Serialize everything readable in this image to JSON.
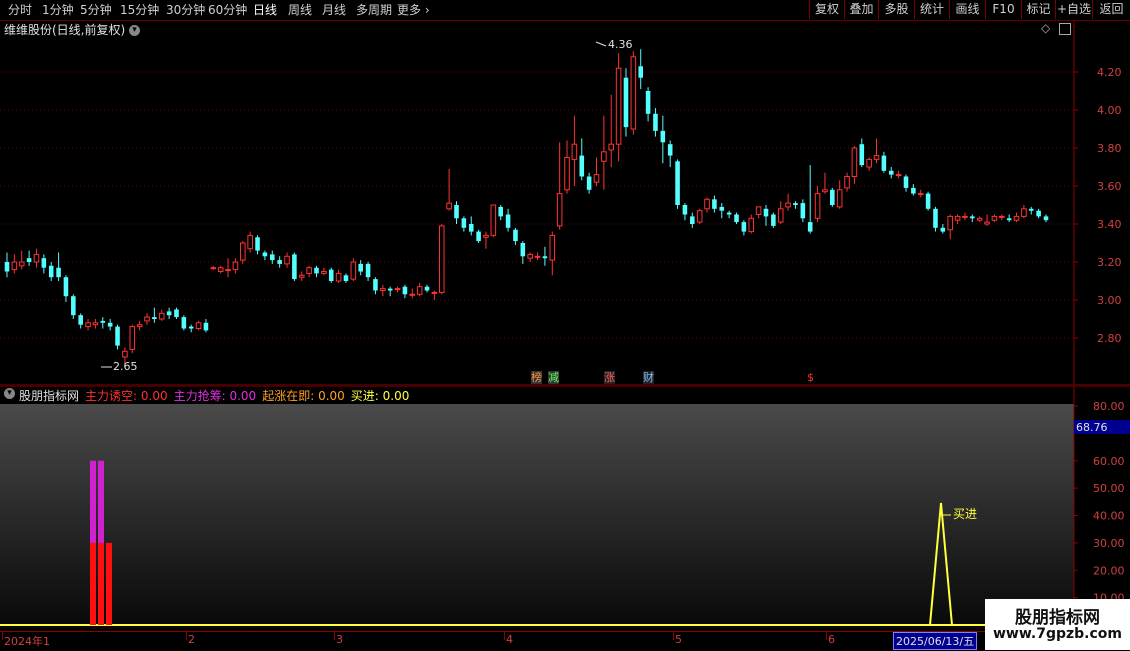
{
  "toolbar": {
    "periods": [
      "分时",
      "1分钟",
      "5分钟",
      "15分钟",
      "30分钟",
      "60分钟",
      "日线",
      "周线",
      "月线",
      "多周期",
      "更多"
    ],
    "more_arrow": "›",
    "right_buttons": [
      "复权",
      "叠加",
      "多股",
      "统计",
      "画线",
      "F10",
      "标记",
      "+自选",
      "返回"
    ],
    "active": "日线"
  },
  "main_panel": {
    "title": "维维股份(日线,前复权)",
    "price_ticks": [
      "4.20",
      "4.00",
      "3.80",
      "3.60",
      "3.40",
      "3.20",
      "3.00",
      "2.80"
    ],
    "high_label": "4.36",
    "low_label": "2.65",
    "markers": [
      "榜",
      "减",
      "涨",
      "财",
      "$"
    ]
  },
  "indicator_panel": {
    "name": "股朋指标网",
    "items": [
      {
        "label": "主力诱空:",
        "value": "0.00",
        "color": "#ff3030"
      },
      {
        "label": "主力抢筹:",
        "value": "0.00",
        "color": "#e030e0"
      },
      {
        "label": "起涨在即:",
        "value": "0.00",
        "color": "#ffa020"
      },
      {
        "label": "买进:",
        "value": "0.00",
        "color": "#ffff40"
      }
    ],
    "y_ticks": [
      "80.00",
      "60.00",
      "50.00",
      "40.00",
      "30.00",
      "20.00",
      "10.00"
    ],
    "current_value": "68.76",
    "buy_label": "买进"
  },
  "date_axis": {
    "labels": [
      "2024年1",
      "2",
      "3",
      "4",
      "5",
      "6"
    ],
    "cursor_date": "2025/06/13/五"
  },
  "watermark": {
    "line1": "股朋指标网",
    "line2": "www.7gpzb.com"
  },
  "chart_data": {
    "type": "candlestick",
    "title": "维维股份(日线,前复权)",
    "ylim": [
      2.6,
      4.45
    ],
    "price_ticks": [
      2.8,
      3.0,
      3.2,
      3.4,
      3.6,
      3.8,
      4.0,
      4.2
    ],
    "annotations": [
      {
        "label": "4.36",
        "type": "high"
      },
      {
        "label": "2.65",
        "type": "low"
      }
    ],
    "candles": [
      [
        3.2,
        3.15,
        3.25,
        3.12
      ],
      [
        3.16,
        3.2,
        3.24,
        3.14
      ],
      [
        3.18,
        3.2,
        3.26,
        3.16
      ],
      [
        3.22,
        3.2,
        3.26,
        3.18
      ],
      [
        3.2,
        3.24,
        3.27,
        3.17
      ],
      [
        3.22,
        3.17,
        3.24,
        3.14
      ],
      [
        3.18,
        3.12,
        3.2,
        3.1
      ],
      [
        3.17,
        3.12,
        3.25,
        3.1
      ],
      [
        3.12,
        3.02,
        3.13,
        2.99
      ],
      [
        3.02,
        2.92,
        3.03,
        2.9
      ],
      [
        2.92,
        2.87,
        2.93,
        2.85
      ],
      [
        2.86,
        2.88,
        2.9,
        2.84
      ],
      [
        2.87,
        2.88,
        2.9,
        2.85
      ],
      [
        2.89,
        2.88,
        2.91,
        2.85
      ],
      [
        2.88,
        2.86,
        2.9,
        2.84
      ],
      [
        2.86,
        2.76,
        2.87,
        2.74
      ],
      [
        2.7,
        2.73,
        2.75,
        2.65
      ],
      [
        2.74,
        2.86,
        2.87,
        2.72
      ],
      [
        2.86,
        2.87,
        2.89,
        2.84
      ],
      [
        2.89,
        2.91,
        2.93,
        2.87
      ],
      [
        2.91,
        2.9,
        2.96,
        2.88
      ],
      [
        2.9,
        2.93,
        2.95,
        2.89
      ],
      [
        2.94,
        2.92,
        2.96,
        2.9
      ],
      [
        2.95,
        2.91,
        2.96,
        2.9
      ],
      [
        2.91,
        2.85,
        2.92,
        2.84
      ],
      [
        2.86,
        2.85,
        2.87,
        2.83
      ],
      [
        2.85,
        2.88,
        2.89,
        2.84
      ],
      [
        2.88,
        2.84,
        2.9,
        2.83
      ],
      [
        3.17,
        3.17,
        3.18,
        3.16
      ],
      [
        3.15,
        3.17,
        3.18,
        3.14
      ],
      [
        3.16,
        3.16,
        3.22,
        3.12
      ],
      [
        3.16,
        3.2,
        3.22,
        3.14
      ],
      [
        3.21,
        3.3,
        3.31,
        3.19
      ],
      [
        3.27,
        3.34,
        3.36,
        3.25
      ],
      [
        3.33,
        3.26,
        3.34,
        3.24
      ],
      [
        3.25,
        3.23,
        3.26,
        3.21
      ],
      [
        3.24,
        3.21,
        3.26,
        3.19
      ],
      [
        3.21,
        3.19,
        3.23,
        3.17
      ],
      [
        3.19,
        3.23,
        3.25,
        3.17
      ],
      [
        3.24,
        3.11,
        3.25,
        3.1
      ],
      [
        3.12,
        3.13,
        3.15,
        3.1
      ],
      [
        3.14,
        3.17,
        3.18,
        3.12
      ],
      [
        3.17,
        3.14,
        3.18,
        3.12
      ],
      [
        3.14,
        3.15,
        3.17,
        3.13
      ],
      [
        3.16,
        3.1,
        3.17,
        3.09
      ],
      [
        3.1,
        3.14,
        3.16,
        3.09
      ],
      [
        3.13,
        3.1,
        3.14,
        3.09
      ],
      [
        3.11,
        3.2,
        3.22,
        3.1
      ],
      [
        3.19,
        3.15,
        3.21,
        3.13
      ],
      [
        3.19,
        3.12,
        3.2,
        3.1
      ],
      [
        3.11,
        3.05,
        3.12,
        3.03
      ],
      [
        3.05,
        3.06,
        3.08,
        3.02
      ],
      [
        3.06,
        3.05,
        3.07,
        3.02
      ],
      [
        3.06,
        3.06,
        3.07,
        3.04
      ],
      [
        3.07,
        3.03,
        3.08,
        3.01
      ],
      [
        3.03,
        3.03,
        3.06,
        3.01
      ],
      [
        3.03,
        3.07,
        3.09,
        3.02
      ],
      [
        3.07,
        3.05,
        3.08,
        3.04
      ],
      [
        3.04,
        3.04,
        3.05,
        3.0
      ],
      [
        3.04,
        3.39,
        3.4,
        3.03
      ],
      [
        3.48,
        3.51,
        3.69,
        3.47
      ],
      [
        3.5,
        3.43,
        3.52,
        3.4
      ],
      [
        3.43,
        3.38,
        3.44,
        3.36
      ],
      [
        3.4,
        3.36,
        3.44,
        3.34
      ],
      [
        3.36,
        3.31,
        3.37,
        3.3
      ],
      [
        3.33,
        3.34,
        3.36,
        3.27
      ],
      [
        3.34,
        3.5,
        3.5,
        3.33
      ],
      [
        3.49,
        3.44,
        3.5,
        3.42
      ],
      [
        3.45,
        3.38,
        3.48,
        3.36
      ],
      [
        3.37,
        3.31,
        3.38,
        3.29
      ],
      [
        3.3,
        3.23,
        3.31,
        3.19
      ],
      [
        3.22,
        3.24,
        3.25,
        3.2
      ],
      [
        3.23,
        3.23,
        3.25,
        3.21
      ],
      [
        3.23,
        3.22,
        3.28,
        3.18
      ],
      [
        3.21,
        3.34,
        3.36,
        3.13
      ],
      [
        3.39,
        3.56,
        3.83,
        3.37
      ],
      [
        3.58,
        3.75,
        3.84,
        3.56
      ],
      [
        3.74,
        3.82,
        3.97,
        3.6
      ],
      [
        3.76,
        3.65,
        3.85,
        3.63
      ],
      [
        3.65,
        3.58,
        3.67,
        3.56
      ],
      [
        3.62,
        3.66,
        3.75,
        3.6
      ],
      [
        3.73,
        3.78,
        3.97,
        3.58
      ],
      [
        3.79,
        3.82,
        4.08,
        3.7
      ],
      [
        3.82,
        4.22,
        4.3,
        3.73
      ],
      [
        4.17,
        3.91,
        4.22,
        3.86
      ],
      [
        3.9,
        4.28,
        4.31,
        3.87
      ],
      [
        4.23,
        4.17,
        4.32,
        4.11
      ],
      [
        4.1,
        3.98,
        4.12,
        3.94
      ],
      [
        3.98,
        3.89,
        4.01,
        3.86
      ],
      [
        3.89,
        3.83,
        3.97,
        3.72
      ],
      [
        3.82,
        3.76,
        3.84,
        3.7
      ],
      [
        3.73,
        3.5,
        3.74,
        3.48
      ],
      [
        3.5,
        3.45,
        3.51,
        3.42
      ],
      [
        3.44,
        3.4,
        3.46,
        3.38
      ],
      [
        3.41,
        3.47,
        3.48,
        3.4
      ],
      [
        3.48,
        3.53,
        3.54,
        3.46
      ],
      [
        3.53,
        3.48,
        3.55,
        3.46
      ],
      [
        3.49,
        3.47,
        3.51,
        3.43
      ],
      [
        3.46,
        3.45,
        3.47,
        3.43
      ],
      [
        3.45,
        3.41,
        3.46,
        3.4
      ],
      [
        3.41,
        3.36,
        3.42,
        3.34
      ],
      [
        3.36,
        3.43,
        3.45,
        3.35
      ],
      [
        3.45,
        3.49,
        3.49,
        3.43
      ],
      [
        3.48,
        3.44,
        3.5,
        3.39
      ],
      [
        3.45,
        3.39,
        3.46,
        3.38
      ],
      [
        3.41,
        3.48,
        3.52,
        3.4
      ],
      [
        3.49,
        3.51,
        3.56,
        3.47
      ],
      [
        3.51,
        3.5,
        3.52,
        3.48
      ],
      [
        3.51,
        3.43,
        3.53,
        3.41
      ],
      [
        3.41,
        3.36,
        3.71,
        3.35
      ],
      [
        3.43,
        3.56,
        3.6,
        3.41
      ],
      [
        3.57,
        3.58,
        3.67,
        3.56
      ],
      [
        3.58,
        3.5,
        3.59,
        3.49
      ],
      [
        3.49,
        3.58,
        3.63,
        3.48
      ],
      [
        3.59,
        3.65,
        3.67,
        3.57
      ],
      [
        3.65,
        3.8,
        3.81,
        3.61
      ],
      [
        3.82,
        3.71,
        3.85,
        3.7
      ],
      [
        3.7,
        3.74,
        3.75,
        3.68
      ],
      [
        3.74,
        3.76,
        3.85,
        3.72
      ],
      [
        3.76,
        3.68,
        3.78,
        3.67
      ],
      [
        3.68,
        3.66,
        3.7,
        3.64
      ],
      [
        3.66,
        3.66,
        3.68,
        3.64
      ],
      [
        3.65,
        3.59,
        3.66,
        3.57
      ],
      [
        3.59,
        3.56,
        3.61,
        3.55
      ],
      [
        3.56,
        3.56,
        3.58,
        3.54
      ],
      [
        3.56,
        3.48,
        3.57,
        3.47
      ],
      [
        3.48,
        3.38,
        3.49,
        3.36
      ],
      [
        3.38,
        3.36,
        3.4,
        3.35
      ],
      [
        3.37,
        3.44,
        3.45,
        3.32
      ],
      [
        3.42,
        3.44,
        3.45,
        3.4
      ],
      [
        3.44,
        3.44,
        3.46,
        3.42
      ],
      [
        3.44,
        3.43,
        3.45,
        3.41
      ],
      [
        3.42,
        3.43,
        3.44,
        3.41
      ],
      [
        3.4,
        3.41,
        3.45,
        3.39
      ],
      [
        3.42,
        3.44,
        3.45,
        3.41
      ],
      [
        3.44,
        3.44,
        3.45,
        3.42
      ],
      [
        3.43,
        3.42,
        3.45,
        3.41
      ],
      [
        3.42,
        3.44,
        3.46,
        3.41
      ],
      [
        3.44,
        3.48,
        3.5,
        3.43
      ],
      [
        3.48,
        3.47,
        3.49,
        3.45
      ],
      [
        3.47,
        3.44,
        3.48,
        3.43
      ],
      [
        3.44,
        3.42,
        3.45,
        3.41
      ]
    ]
  }
}
